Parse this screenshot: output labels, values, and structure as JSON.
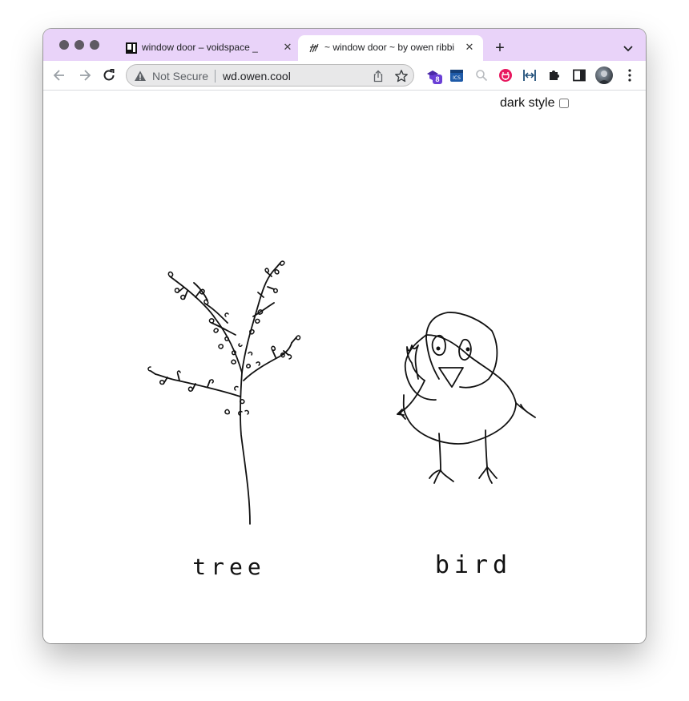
{
  "window": {
    "controls": [
      "close",
      "minimize",
      "maximize"
    ]
  },
  "tabs": [
    {
      "title": "window door – voidspace _",
      "favicon": "voidspace-favicon",
      "active": false
    },
    {
      "title": "~ window door ~ by owen ribbit",
      "favicon": "scribble-favicon",
      "active": true
    }
  ],
  "tab_close_glyph": "✕",
  "new_tab_glyph": "+",
  "toolbar": {
    "security_label": "Not Secure",
    "url": "wd.owen.cool",
    "extensions": [
      {
        "name": "purple-extension-icon",
        "badge": "8"
      },
      {
        "name": "ics-calendar-icon",
        "badge": ""
      },
      {
        "name": "magnifier-icon",
        "badge": ""
      },
      {
        "name": "pink-plug-icon",
        "badge": ""
      },
      {
        "name": "resize-icon",
        "badge": ""
      },
      {
        "name": "puzzle-icon",
        "badge": ""
      },
      {
        "name": "side-panel-icon",
        "badge": ""
      }
    ]
  },
  "page": {
    "dark_style_label": "dark style",
    "dark_style_checked": false,
    "drawings": [
      {
        "name": "tree-drawing",
        "caption": "tree"
      },
      {
        "name": "bird-drawing",
        "caption": "bird"
      }
    ]
  },
  "colors": {
    "tabstrip": "#e9d3f9",
    "ink": "#111111"
  }
}
